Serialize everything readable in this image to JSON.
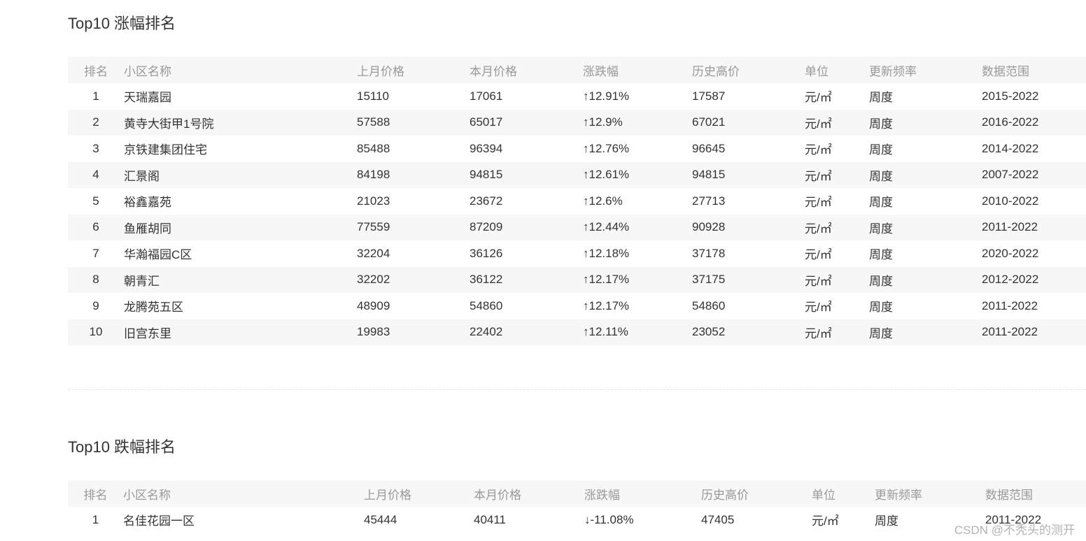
{
  "rise": {
    "title": "Top10 涨幅排名",
    "headers": [
      "排名",
      "小区名称",
      "上月价格",
      "本月价格",
      "涨跌幅",
      "历史高价",
      "单位",
      "更新频率",
      "数据范围"
    ],
    "rows": [
      {
        "rank": "1",
        "name": "天瑞嘉园",
        "last": "15110",
        "current": "17061",
        "change": "↑12.91%",
        "high": "17587",
        "unit": "元/㎡",
        "freq": "周度",
        "range": "2015-2022"
      },
      {
        "rank": "2",
        "name": "黄寺大街甲1号院",
        "last": "57588",
        "current": "65017",
        "change": "↑12.9%",
        "high": "67021",
        "unit": "元/㎡",
        "freq": "周度",
        "range": "2016-2022"
      },
      {
        "rank": "3",
        "name": "京铁建集团住宅",
        "last": "85488",
        "current": "96394",
        "change": "↑12.76%",
        "high": "96645",
        "unit": "元/㎡",
        "freq": "周度",
        "range": "2014-2022"
      },
      {
        "rank": "4",
        "name": "汇景阁",
        "last": "84198",
        "current": "94815",
        "change": "↑12.61%",
        "high": "94815",
        "unit": "元/㎡",
        "freq": "周度",
        "range": "2007-2022"
      },
      {
        "rank": "5",
        "name": "裕鑫嘉苑",
        "last": "21023",
        "current": "23672",
        "change": "↑12.6%",
        "high": "27713",
        "unit": "元/㎡",
        "freq": "周度",
        "range": "2010-2022"
      },
      {
        "rank": "6",
        "name": "鱼雁胡同",
        "last": "77559",
        "current": "87209",
        "change": "↑12.44%",
        "high": "90928",
        "unit": "元/㎡",
        "freq": "周度",
        "range": "2011-2022"
      },
      {
        "rank": "7",
        "name": "华瀚福园C区",
        "last": "32204",
        "current": "36126",
        "change": "↑12.18%",
        "high": "37178",
        "unit": "元/㎡",
        "freq": "周度",
        "range": "2020-2022"
      },
      {
        "rank": "8",
        "name": "朝青汇",
        "last": "32202",
        "current": "36122",
        "change": "↑12.17%",
        "high": "37175",
        "unit": "元/㎡",
        "freq": "周度",
        "range": "2012-2022"
      },
      {
        "rank": "9",
        "name": "龙腾苑五区",
        "last": "48909",
        "current": "54860",
        "change": "↑12.17%",
        "high": "54860",
        "unit": "元/㎡",
        "freq": "周度",
        "range": "2011-2022"
      },
      {
        "rank": "10",
        "name": "旧宫东里",
        "last": "19983",
        "current": "22402",
        "change": "↑12.11%",
        "high": "23052",
        "unit": "元/㎡",
        "freq": "周度",
        "range": "2011-2022"
      }
    ]
  },
  "fall": {
    "title": "Top10 跌幅排名",
    "headers": [
      "排名",
      "小区名称",
      "上月价格",
      "本月价格",
      "涨跌幅",
      "历史高价",
      "单位",
      "更新频率",
      "数据范围"
    ],
    "rows": [
      {
        "rank": "1",
        "name": "名佳花园一区",
        "last": "45444",
        "current": "40411",
        "change": "↓-11.08%",
        "high": "47405",
        "unit": "元/㎡",
        "freq": "周度",
        "range": "2011-2022"
      }
    ]
  },
  "colors": {
    "rise": "#ef7a2c",
    "fall": "#19a558",
    "header_bg": "#f7f7f7",
    "header_text": "#999999"
  },
  "watermark": "CSDN @不秃头的测开"
}
